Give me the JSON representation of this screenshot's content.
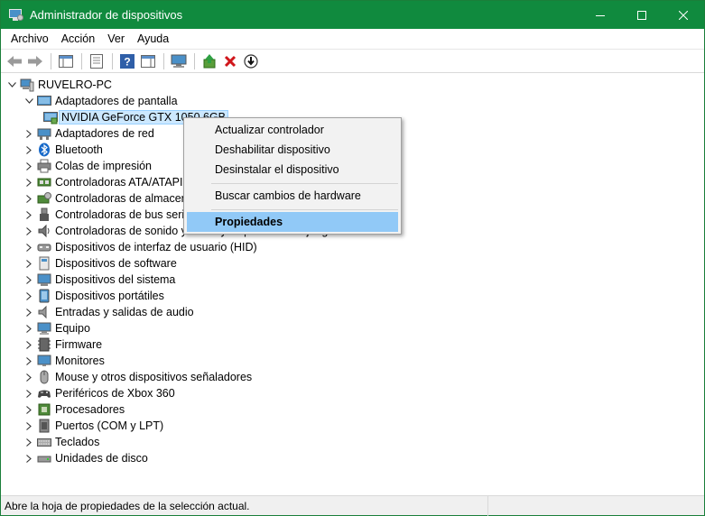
{
  "window": {
    "title": "Administrador de dispositivos"
  },
  "menu": [
    "Archivo",
    "Acción",
    "Ver",
    "Ayuda"
  ],
  "toolbar": {
    "icons": [
      "back-arrow-icon",
      "forward-arrow-icon",
      "show-hide-console-tree-icon",
      "properties-icon",
      "help-icon",
      "action-pane-icon",
      "monitor-scan-icon",
      "update-driver-icon",
      "uninstall-x-icon",
      "disable-device-icon"
    ]
  },
  "tree": {
    "root": "RUVELRO-PC",
    "categories": [
      {
        "label": "Adaptadores de pantalla",
        "expanded": true,
        "icon": "display-adapter-icon",
        "children": [
          {
            "label": "NVIDIA GeForce GTX 1050 6GB",
            "icon": "gpu-icon",
            "selected": true
          }
        ]
      },
      {
        "label": "Adaptadores de red",
        "icon": "network-adapter-icon"
      },
      {
        "label": "Bluetooth",
        "icon": "bluetooth-icon"
      },
      {
        "label": "Colas de impresión",
        "icon": "printer-icon"
      },
      {
        "label": "Controladoras ATA/ATAPI IDE",
        "icon": "ide-controller-icon"
      },
      {
        "label": "Controladoras de almacenamiento",
        "icon": "storage-controller-icon"
      },
      {
        "label": "Controladoras de bus serie universal",
        "icon": "usb-icon"
      },
      {
        "label": "Controladoras de sonido y vídeo y dispositivos de juego",
        "icon": "speaker-icon"
      },
      {
        "label": "Dispositivos de interfaz de usuario (HID)",
        "icon": "hid-icon"
      },
      {
        "label": "Dispositivos de software",
        "icon": "software-device-icon"
      },
      {
        "label": "Dispositivos del sistema",
        "icon": "system-device-icon"
      },
      {
        "label": "Dispositivos portátiles",
        "icon": "portable-device-icon"
      },
      {
        "label": "Entradas y salidas de audio",
        "icon": "audio-io-icon"
      },
      {
        "label": "Equipo",
        "icon": "computer-icon"
      },
      {
        "label": "Firmware",
        "icon": "firmware-icon"
      },
      {
        "label": "Monitores",
        "icon": "monitor-icon"
      },
      {
        "label": "Mouse y otros dispositivos señaladores",
        "icon": "mouse-icon"
      },
      {
        "label": "Periféricos de Xbox 360",
        "icon": "gamepad-icon"
      },
      {
        "label": "Procesadores",
        "icon": "processor-icon"
      },
      {
        "label": "Puertos (COM y LPT)",
        "icon": "port-icon"
      },
      {
        "label": "Teclados",
        "icon": "keyboard-icon"
      },
      {
        "label": "Unidades de disco",
        "icon": "disk-drive-icon"
      }
    ]
  },
  "context_menu": {
    "items": [
      "Actualizar controlador",
      "Deshabilitar dispositivo",
      "Desinstalar el dispositivo",
      "Buscar cambios de hardware",
      "Propiedades"
    ],
    "active": "Propiedades"
  },
  "status": {
    "text": "Abre la hoja de propiedades de la selección actual."
  },
  "colors": {
    "titlebar": "#108a3e",
    "highlight": "#91c9f7",
    "selection": "#cce8ff"
  }
}
